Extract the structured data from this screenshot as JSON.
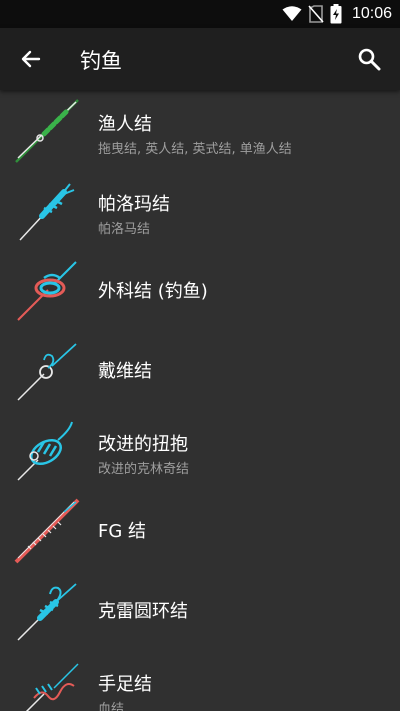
{
  "status_bar": {
    "time": "10:06",
    "icons": [
      "wifi-icon",
      "no-sim-icon",
      "battery-charging-icon"
    ]
  },
  "app_bar": {
    "title": "钓鱼",
    "back_icon": "arrow-left-icon",
    "search_icon": "search-icon"
  },
  "knots": [
    {
      "title": "渔人结",
      "subtitle": "拖曳结, 英人结, 英式结, 单渔人结",
      "icon": "fishermans-knot-icon"
    },
    {
      "title": "帕洛玛结",
      "subtitle": "帕洛马结",
      "icon": "palomar-knot-icon"
    },
    {
      "title": "外科结 (钓鱼)",
      "subtitle": "",
      "icon": "surgeons-knot-icon"
    },
    {
      "title": "戴维结",
      "subtitle": "",
      "icon": "davy-knot-icon"
    },
    {
      "title": "改进的扭抱",
      "subtitle": "改进的克林奇结",
      "icon": "improved-clinch-knot-icon"
    },
    {
      "title": "FG 结",
      "subtitle": "",
      "icon": "fg-knot-icon"
    },
    {
      "title": "克雷圆环结",
      "subtitle": "",
      "icon": "uni-knot-icon"
    },
    {
      "title": "手足结",
      "subtitle": "血结",
      "icon": "blood-knot-icon"
    }
  ],
  "colors": {
    "background": "#303030",
    "app_bar": "#1f1f1f",
    "status_bar": "#0d0d0d",
    "knot_cyan": "#29c5e6",
    "knot_red": "#e45b57",
    "knot_green": "#2f8f3a",
    "line_white": "#e8e8e8"
  }
}
